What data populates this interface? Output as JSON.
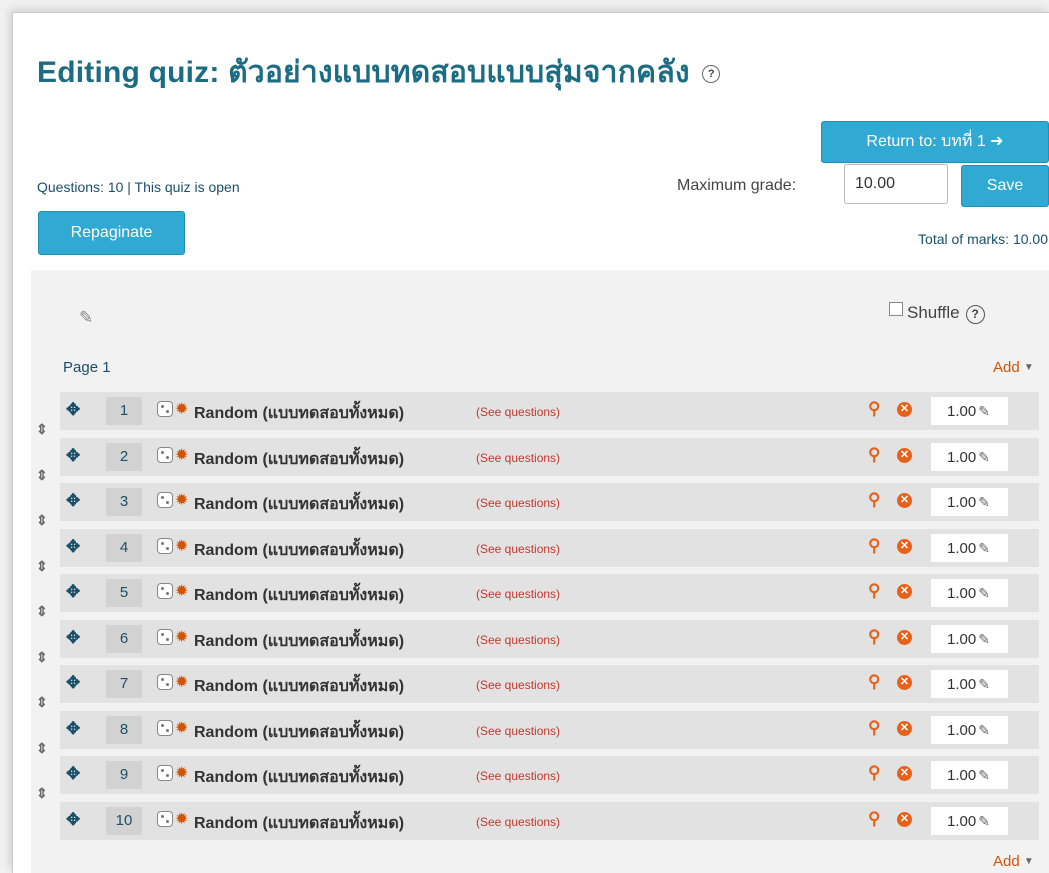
{
  "header": {
    "title": "Editing quiz: ตัวอย่างแบบทดสอบแบบสุ่มจากคลัง",
    "help_glyph": "?",
    "return_button": "Return to: บทที่ 1 ➜",
    "questions_info": "Questions: 10 | This quiz is open",
    "maximum_grade_label": "Maximum grade:",
    "maximum_grade_value": "10.00",
    "save_button": "Save",
    "repaginate_button": "Repaginate",
    "total_marks": "Total of marks: 10.00"
  },
  "section": {
    "shuffle_label": "Shuffle",
    "page_label": "Page 1",
    "add_label": "Add"
  },
  "questions": [
    {
      "number": "1",
      "name": "Random (แบบทดสอบทั้งหมด)",
      "see_questions": "(See questions)",
      "mark": "1.00"
    },
    {
      "number": "2",
      "name": "Random (แบบทดสอบทั้งหมด)",
      "see_questions": "(See questions)",
      "mark": "1.00"
    },
    {
      "number": "3",
      "name": "Random (แบบทดสอบทั้งหมด)",
      "see_questions": "(See questions)",
      "mark": "1.00"
    },
    {
      "number": "4",
      "name": "Random (แบบทดสอบทั้งหมด)",
      "see_questions": "(See questions)",
      "mark": "1.00"
    },
    {
      "number": "5",
      "name": "Random (แบบทดสอบทั้งหมด)",
      "see_questions": "(See questions)",
      "mark": "1.00"
    },
    {
      "number": "6",
      "name": "Random (แบบทดสอบทั้งหมด)",
      "see_questions": "(See questions)",
      "mark": "1.00"
    },
    {
      "number": "7",
      "name": "Random (แบบทดสอบทั้งหมด)",
      "see_questions": "(See questions)",
      "mark": "1.00"
    },
    {
      "number": "8",
      "name": "Random (แบบทดสอบทั้งหมด)",
      "see_questions": "(See questions)",
      "mark": "1.00"
    },
    {
      "number": "9",
      "name": "Random (แบบทดสอบทั้งหมด)",
      "see_questions": "(See questions)",
      "mark": "1.00"
    },
    {
      "number": "10",
      "name": "Random (แบบทดสอบทั้งหมด)",
      "see_questions": "(See questions)",
      "mark": "1.00"
    }
  ],
  "icons": {
    "move": "move-icon",
    "random": "dice-icon",
    "settings": "gear-icon",
    "preview": "search-icon",
    "delete": "delete-icon",
    "edit": "pencil-icon",
    "page_break": "page-break-icon"
  },
  "colors": {
    "title": "#1c6c84",
    "button": "#30a9d3",
    "action": "#e8611a",
    "link": "#1a4f6a"
  }
}
